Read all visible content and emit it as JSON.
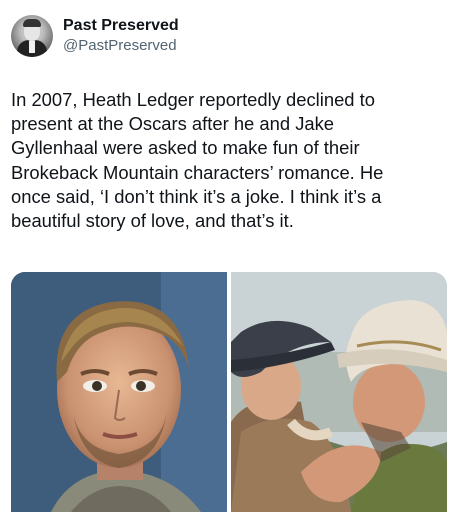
{
  "post": {
    "display_name": "Past Preserved",
    "handle": "@PastPreserved",
    "text": "In 2007, Heath Ledger reportedly declined to\npresent at the Oscars after he and Jake\nGyllenhaal were asked to make fun of their\nBrokeback Mountain characters’ romance. He\nonce said, ‘I don’t think it’s a joke. I think it’s a\nbeautiful story of love, and that’s it."
  },
  "media": {
    "photo_left_icon": "portrait-photo-icon",
    "photo_right_icon": "film-still-photo-icon"
  }
}
